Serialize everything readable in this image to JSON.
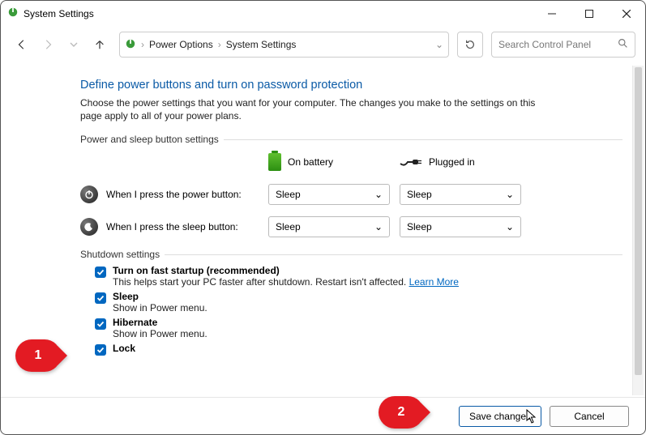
{
  "window": {
    "title": "System Settings"
  },
  "breadcrumb": {
    "root": "Power Options",
    "leaf": "System Settings"
  },
  "search": {
    "placeholder": "Search Control Panel"
  },
  "page": {
    "heading": "Define power buttons and turn on password protection",
    "intro": "Choose the power settings that you want for your computer. The changes you make to the settings on this page apply to all of your power plans.",
    "section1_label": "Power and sleep button settings",
    "col_battery": "On battery",
    "col_plugged": "Plugged in",
    "row_power": "When I press the power button:",
    "row_sleep": "When I press the sleep button:",
    "sel_power_battery": "Sleep",
    "sel_power_plugged": "Sleep",
    "sel_sleep_battery": "Sleep",
    "sel_sleep_plugged": "Sleep",
    "section2_label": "Shutdown settings",
    "opt_fast_title": "Turn on fast startup (recommended)",
    "opt_fast_desc": "This helps start your PC faster after shutdown. Restart isn't affected. ",
    "opt_fast_link": "Learn More",
    "opt_sleep_title": "Sleep",
    "opt_sleep_desc": "Show in Power menu.",
    "opt_hibernate_title": "Hibernate",
    "opt_hibernate_desc": "Show in Power menu.",
    "opt_lock_title": "Lock"
  },
  "footer": {
    "save": "Save changes",
    "cancel": "Cancel"
  },
  "callouts": {
    "c1": "1",
    "c2": "2"
  }
}
